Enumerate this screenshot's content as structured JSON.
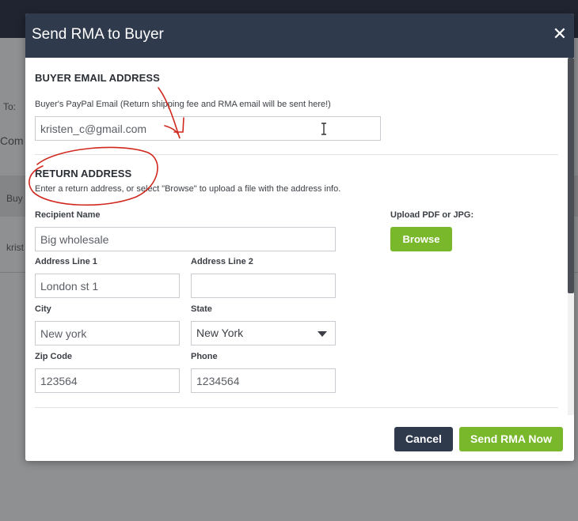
{
  "background": {
    "to_label": "To:",
    "com_label": "Com",
    "buy_label": "Buy",
    "krist_label": "krist"
  },
  "modal": {
    "title": "Send RMA to Buyer",
    "close_glyph": "✕",
    "buyer_email": {
      "section_title": "BUYER EMAIL ADDRESS",
      "field_label": "Buyer's PayPal Email (Return shipping fee and RMA email will be sent here!)",
      "value": "kristen_c@gmail.com"
    },
    "return_address": {
      "section_title": "RETURN ADDRESS",
      "help_text": "Enter a return address, or select \"Browse\" to upload a file with the address info.",
      "recipient_label": "Recipient Name",
      "recipient_value": "Big wholesale",
      "address1_label": "Address Line 1",
      "address1_value": "London st 1",
      "address2_label": "Address Line 2",
      "address2_value": "",
      "city_label": "City",
      "city_value": "New york",
      "state_label": "State",
      "state_value": "New York",
      "zip_label": "Zip Code",
      "zip_value": "123564",
      "phone_label": "Phone",
      "phone_value": "1234564",
      "upload_label": "Upload PDF or JPG:",
      "browse_label": "Browse"
    },
    "footer": {
      "cancel_label": "Cancel",
      "send_label": "Send RMA Now"
    }
  },
  "colors": {
    "header": "#2f3a4d",
    "accent_green": "#78b82a",
    "annotation_red": "#d0281e"
  }
}
